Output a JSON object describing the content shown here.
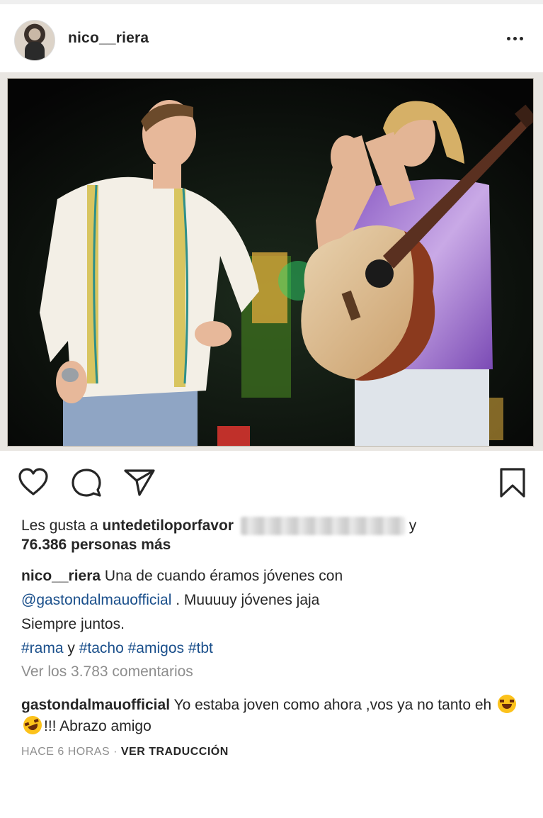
{
  "post": {
    "username": "nico__riera",
    "likes_prefix": "Les gusta a",
    "likes_user": "untedetiloporfavor",
    "likes_suffix": "y",
    "likes_count": "76.386 personas más",
    "caption_user": "nico__riera",
    "caption_text_1": "Una de cuando éramos jóvenes con",
    "caption_mention": "@gastondalmauofficial",
    "caption_text_2": ". Muuuuy jóvenes jaja",
    "caption_text_3": "Siempre juntos.",
    "hashtag_1": "#rama",
    "hashtag_and": "y",
    "hashtag_2": "#tacho",
    "hashtag_3": "#amigos",
    "hashtag_4": "#tbt",
    "view_comments": "Ver los 3.783 comentarios",
    "comment_user": "gastondalmauofficial",
    "comment_text_1": "Yo estaba joven como ahora ,vos ya no tanto eh",
    "comment_text_2": "!!! Abrazo amigo",
    "time_ago": "HACE 6 HORAS",
    "separator": "·",
    "translate": "VER TRADUCCIÓN"
  },
  "icons": {
    "like": "heart-icon",
    "comment": "comment-icon",
    "share": "send-icon",
    "save": "bookmark-icon",
    "more": "more-icon",
    "emoji_1": "laughing-tears-emoji",
    "emoji_2": "rolling-laughing-emoji"
  },
  "colors": {
    "link": "#1a4f8b",
    "muted": "#8e8e8e",
    "text": "#262626"
  }
}
